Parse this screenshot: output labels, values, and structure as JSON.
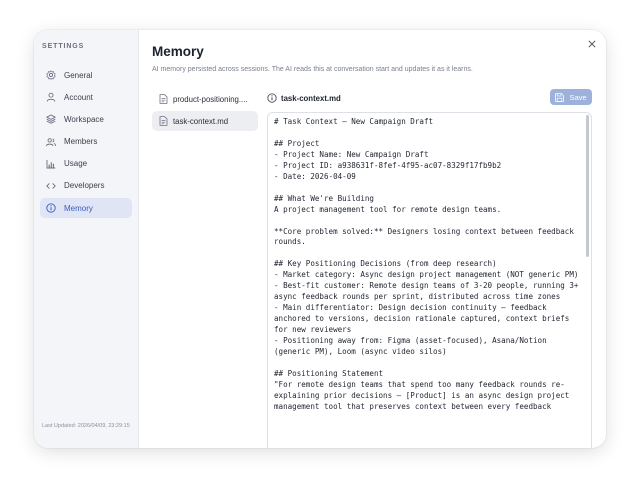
{
  "sidebar": {
    "heading": "SETTINGS",
    "items": [
      {
        "label": "General",
        "icon": "gear-icon"
      },
      {
        "label": "Account",
        "icon": "user-icon"
      },
      {
        "label": "Workspace",
        "icon": "layers-icon"
      },
      {
        "label": "Members",
        "icon": "users-icon"
      },
      {
        "label": "Usage",
        "icon": "bar-chart-icon"
      },
      {
        "label": "Developers",
        "icon": "code-icon"
      },
      {
        "label": "Memory",
        "icon": "info-icon",
        "active": true
      }
    ],
    "footer": "Last Updated: 2026/04/09, 23:29:15"
  },
  "main": {
    "title": "Memory",
    "subtitle": "AI memory persisted across sessions. The AI reads this at conversation start and updates it as it learns.",
    "files": [
      {
        "name": "product-positioning....",
        "icon": "file-icon"
      },
      {
        "name": "task-context.md",
        "icon": "file-icon",
        "active": true
      }
    ],
    "editor": {
      "filename": "task-context.md",
      "save_label": "Save",
      "content": "# Task Context — New Campaign Draft\n\n## Project\n- Project Name: New Campaign Draft\n- Project ID: a938631f-8fef-4f95-ac07-8329f17fb9b2\n- Date: 2026-04-09\n\n## What We're Building\nA project management tool for remote design teams.\n\n**Core problem solved:** Designers losing context between feedback rounds.\n\n## Key Positioning Decisions (from deep research)\n- Market category: Async design project management (NOT generic PM)\n- Best-fit customer: Remote design teams of 3-20 people, running 3+ async feedback rounds per sprint, distributed across time zones\n- Main differentiator: Design decision continuity — feedback anchored to versions, decision rationale captured, context briefs for new reviewers\n- Positioning away from: Figma (asset-focused), Asana/Notion (generic PM), Loom (async video silos)\n\n## Positioning Statement\n\"For remote design teams that spend too many feedback rounds re-explaining prior decisions — [Product] is an async design project management tool that preserves context between every feedback"
    }
  },
  "colors": {
    "accent": "#3a5bbf",
    "active_bg": "#dfe5f4",
    "save_bg": "#9db1da"
  }
}
